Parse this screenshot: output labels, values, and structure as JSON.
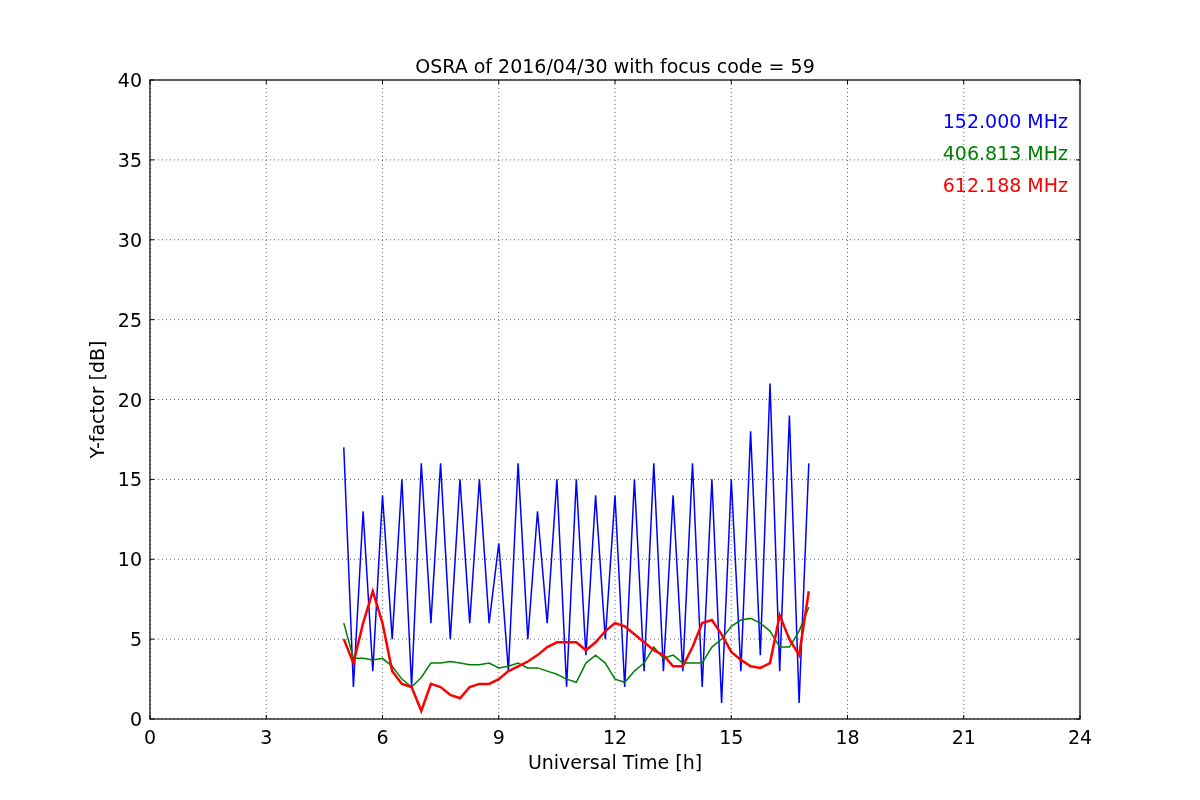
{
  "chart": {
    "chart_data": {
      "type": "line",
      "grid": true,
      "title": "OSRA of 2016/04/30 with focus code = 59",
      "xlabel": "Universal Time [h]",
      "ylabel": "Y-factor [dB]",
      "xlim": [
        0,
        24
      ],
      "ylim": [
        0,
        40
      ],
      "xticks": [
        0,
        3,
        6,
        9,
        12,
        15,
        18,
        21,
        24
      ],
      "yticks": [
        0,
        5,
        10,
        15,
        20,
        25,
        30,
        35,
        40
      ],
      "x": [
        5,
        5.25,
        5.5,
        5.75,
        6,
        6.25,
        6.5,
        6.75,
        7,
        7.25,
        7.5,
        7.75,
        8,
        8.25,
        8.5,
        8.75,
        9,
        9.25,
        9.5,
        9.75,
        10,
        10.25,
        10.5,
        10.75,
        11,
        11.25,
        11.5,
        11.75,
        12,
        12.25,
        12.5,
        12.75,
        13,
        13.25,
        13.5,
        13.75,
        14,
        14.25,
        14.5,
        14.75,
        15,
        15.25,
        15.5,
        15.75,
        16,
        16.25,
        16.5,
        16.75,
        17
      ],
      "series": [
        {
          "name": "152.000 MHz",
          "color": "#0000ff",
          "values": [
            17,
            2,
            13,
            3,
            14,
            5,
            15,
            2,
            16,
            6,
            16,
            5,
            15,
            6,
            15,
            6,
            11,
            3,
            16,
            5,
            13,
            6,
            15,
            2,
            15,
            4,
            14,
            5,
            14,
            2,
            15,
            3,
            16,
            3,
            14,
            3,
            16,
            2,
            15,
            1,
            15,
            3,
            18,
            4,
            21,
            3,
            19,
            1,
            16
          ]
        },
        {
          "name": "406.813 MHz",
          "color": "#008000",
          "values": [
            6,
            3.8,
            3.8,
            3.7,
            3.8,
            3.3,
            2.5,
            2,
            2.6,
            3.5,
            3.5,
            3.6,
            3.5,
            3.4,
            3.4,
            3.5,
            3.2,
            3.3,
            3.5,
            3.2,
            3.2,
            3,
            2.8,
            2.5,
            2.3,
            3.5,
            4,
            3.5,
            2.5,
            2.3,
            3,
            3.5,
            4.5,
            3.8,
            4,
            3.5,
            3.5,
            3.5,
            4.5,
            5,
            5.8,
            6.2,
            6.3,
            6,
            5.5,
            4.5,
            4.5,
            5.5,
            7
          ]
        },
        {
          "name": "612.188 MHz",
          "color": "#ff0000",
          "values": [
            5,
            3.5,
            6,
            8,
            6,
            3,
            2.2,
            2,
            0.5,
            2.2,
            2,
            1.5,
            1.3,
            2,
            2.2,
            2.2,
            2.5,
            3,
            3.3,
            3.6,
            4,
            4.5,
            4.8,
            4.8,
            4.8,
            4.3,
            4.8,
            5.5,
            6,
            5.8,
            5.3,
            4.8,
            4.3,
            4,
            3.3,
            3.3,
            4.5,
            6,
            6.2,
            5.3,
            4.2,
            3.7,
            3.3,
            3.2,
            3.5,
            6.5,
            5,
            4,
            8
          ]
        }
      ]
    }
  }
}
